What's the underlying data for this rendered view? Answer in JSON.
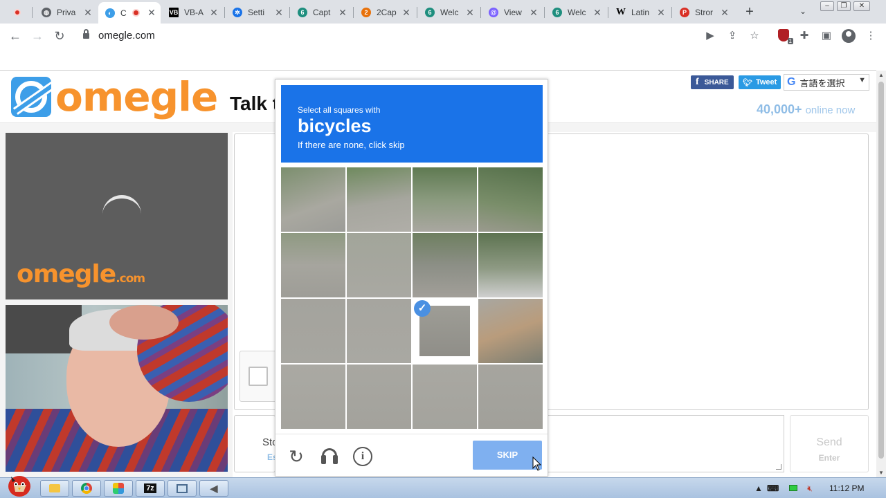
{
  "browser": {
    "tabs": [
      {
        "label": "",
        "icon": "recording-dot-icon",
        "color": "#d93025"
      },
      {
        "label": "Priva",
        "icon": "globe-icon",
        "color": "#5f6368"
      },
      {
        "label": "C",
        "icon": "omegle-favicon-icon",
        "color": "#3d9ee8",
        "active": true
      },
      {
        "label": "VB-A",
        "icon": "vb-favicon-icon",
        "color": "#000000"
      },
      {
        "label": "Setti",
        "icon": "gear-icon",
        "color": "#1a73e8"
      },
      {
        "label": "Capt",
        "icon": "capsolver-icon",
        "color": "#1e8e7e"
      },
      {
        "label": "2Cap",
        "icon": "2captcha-icon",
        "color": "#e8710a"
      },
      {
        "label": "Welc",
        "icon": "capsolver-icon",
        "color": "#1e8e7e"
      },
      {
        "label": "View",
        "icon": "at-icon",
        "color": "#7b61ff"
      },
      {
        "label": "Welc",
        "icon": "capsolver-icon",
        "color": "#1e8e7e"
      },
      {
        "label": "Latin",
        "icon": "wikipedia-icon",
        "color": "#000000"
      },
      {
        "label": "Stror",
        "icon": "p-icon",
        "color": "#d93025"
      }
    ],
    "url": "omegle.com"
  },
  "page": {
    "logo_text": "omegle",
    "tagline": "Talk t",
    "share_label": "SHARE",
    "tweet_label": "Tweet",
    "translate_label": "言語を選択",
    "online_count": "40,000+",
    "online_suffix": "online now",
    "video_logo": "omegle",
    "video_logo_suffix": ".com",
    "stop_label": "Sto",
    "esc_label": "Es",
    "send_label": "Send",
    "enter_label": "Enter"
  },
  "captcha": {
    "pre": "Select all squares with",
    "target": "bicycles",
    "post": "If there are none, click skip",
    "skip_label": "SKIP",
    "selected_tiles": [
      10
    ],
    "header_color": "#1a73e8"
  },
  "taskbar": {
    "clock": "11:12 PM",
    "items": [
      "folder",
      "chrome",
      "apps",
      "7z",
      "network",
      "audio"
    ]
  }
}
